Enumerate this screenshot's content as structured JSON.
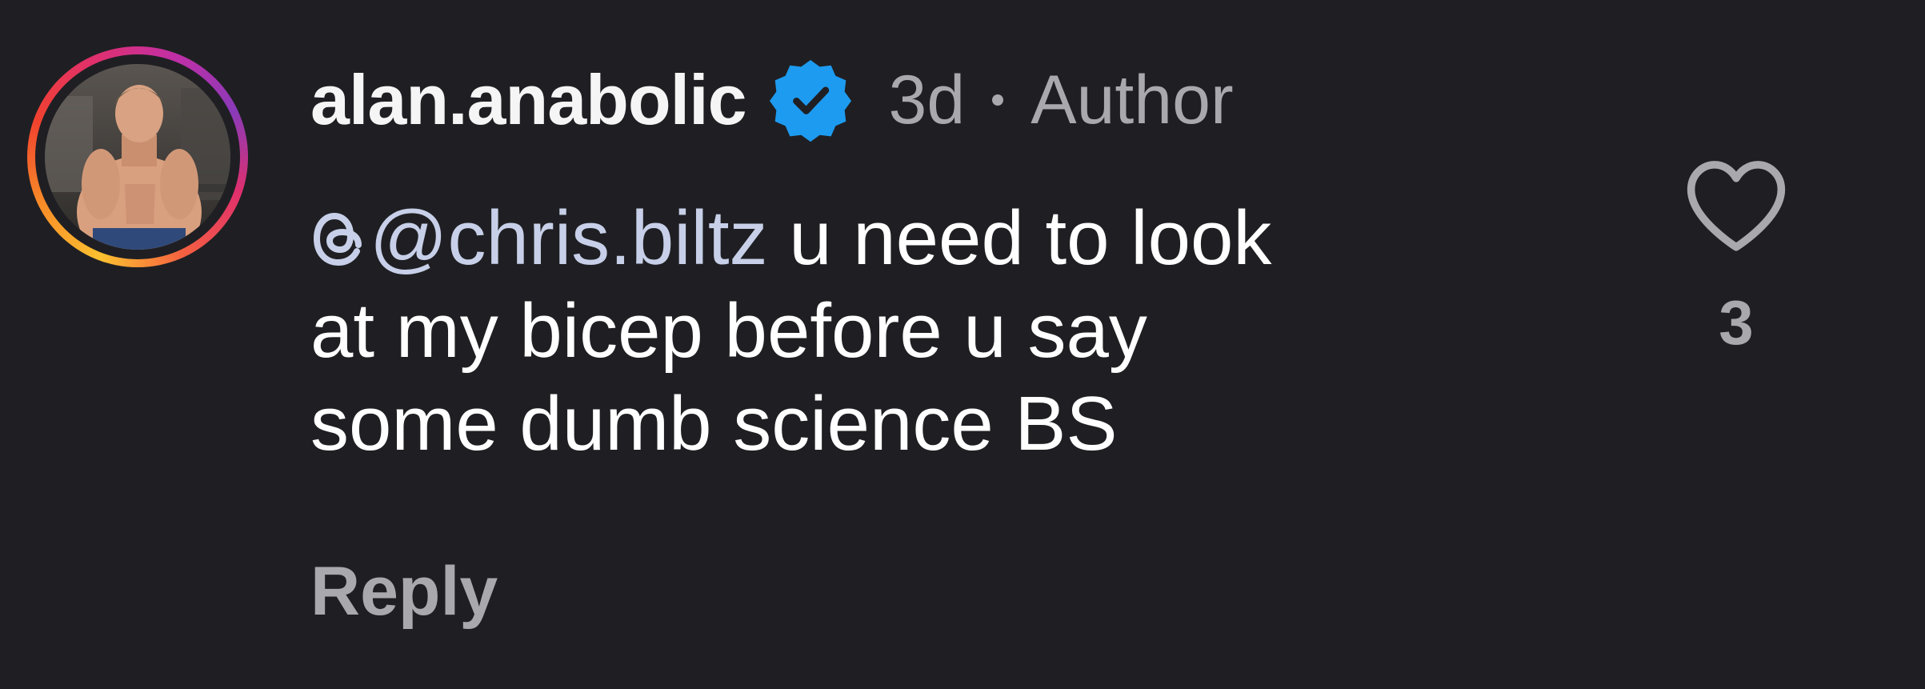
{
  "comment": {
    "username": "alan.anabolic",
    "verified_icon": "verified-badge-icon",
    "time_ago": "3d",
    "role_label": "Author",
    "mention": "@chris.biltz",
    "mention_icon": "threads-icon",
    "text_line1_rest": " u need to look",
    "text_line2": "at my bicep before u say",
    "text_line3": "some dumb science BS",
    "reply_label": "Reply",
    "like_icon": "heart-outline-icon",
    "like_count": "3"
  },
  "colors": {
    "background": "#1f1f23",
    "verified": "#1d9bf0",
    "secondary_text": "#a8a8ad",
    "mention": "#c7d0e8"
  }
}
